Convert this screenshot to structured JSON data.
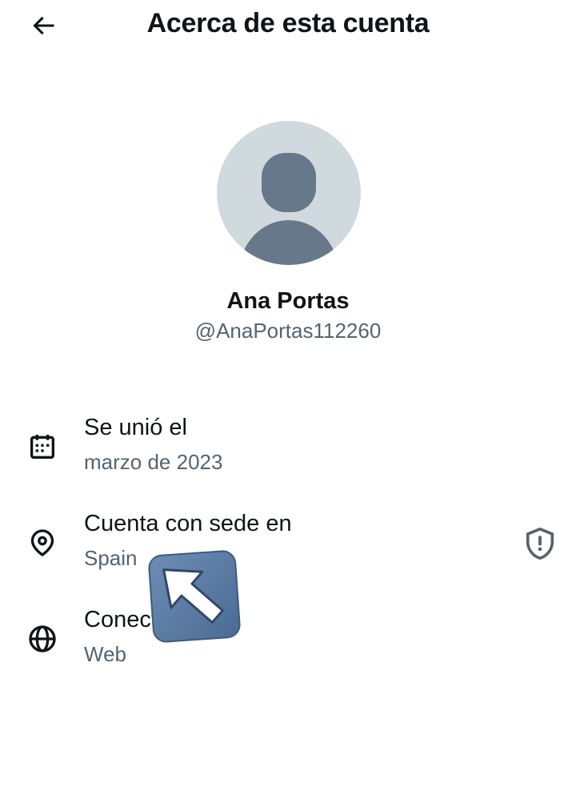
{
  "header": {
    "back_icon": "arrow-left-icon",
    "title": "Acerca de esta cuenta"
  },
  "profile": {
    "avatar_icon": "default-avatar-icon",
    "name": "Ana Portas",
    "handle": "@AnaPortas112260"
  },
  "details": [
    {
      "icon": "calendar-icon",
      "label": "Se unió el",
      "value": "marzo de 2023"
    },
    {
      "icon": "location-pin-icon",
      "label": "Cuenta con sede en",
      "value": "Spain",
      "side_icon": "shield-alert-icon"
    },
    {
      "icon": "globe-icon",
      "label": "Conectado a",
      "value": "Web"
    }
  ],
  "overlay": {
    "icon": "cursor-arrow-icon"
  },
  "colors": {
    "text_primary": "#0f1419",
    "text_secondary": "#536471",
    "avatar_bg": "#cfd9de",
    "avatar_fg": "#66788a",
    "cursor_bg": "#5a7ba3"
  }
}
